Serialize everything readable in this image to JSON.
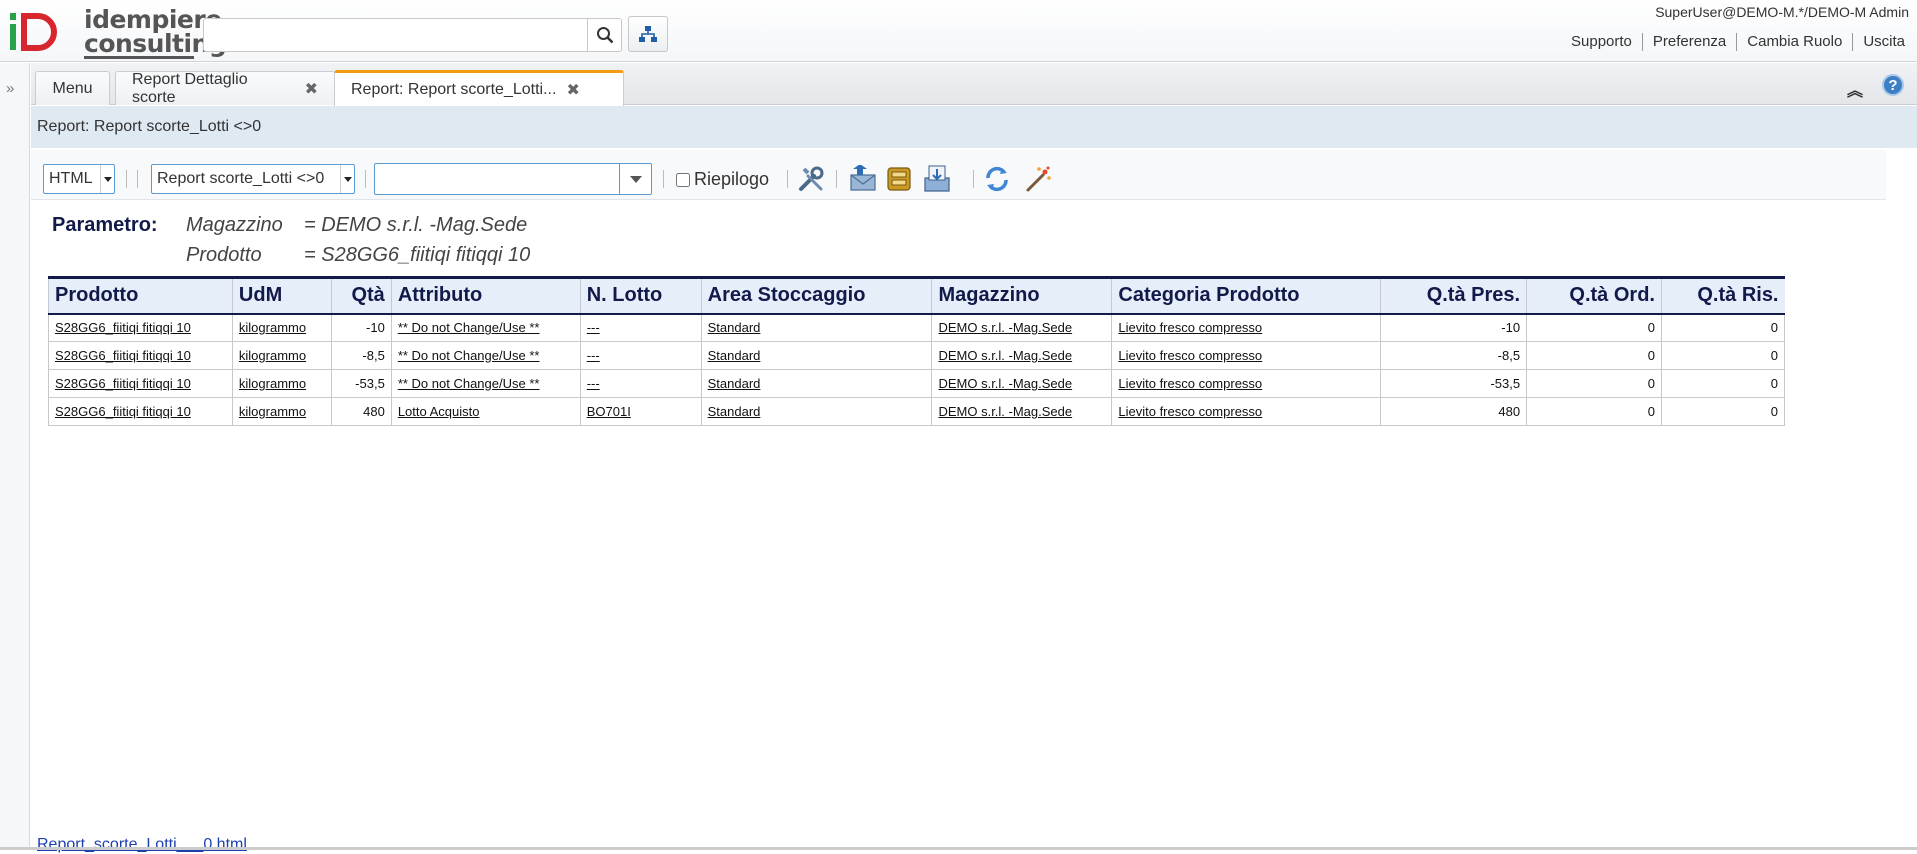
{
  "header": {
    "logo_text_line1": "idempiere",
    "logo_text_line2": "consulting",
    "search_placeholder": "",
    "user": "SuperUser@DEMO-M.*/DEMO-M Admin",
    "links": [
      "Supporto",
      "Preferenza",
      "Cambia Ruolo",
      "Uscita"
    ]
  },
  "tabs": {
    "menu": "Menu",
    "detail": "Report Dettaglio scorte",
    "report": "Report: Report scorte_Lotti...",
    "close_glyph": "✖"
  },
  "title_strip": "Report: Report scorte_Lotti <>0",
  "toolbar": {
    "format": "HTML",
    "report": "Report scorte_Lotti <>0",
    "combo_value": "",
    "summary_label": "Riepilogo"
  },
  "parameters": {
    "label": "Parametro:",
    "rows": [
      {
        "key": "Magazzino",
        "value": "= DEMO s.r.l. -Mag.Sede"
      },
      {
        "key": "Prodotto",
        "value": "= S28GG6_fiitiqi fitiqqi 10"
      }
    ]
  },
  "table": {
    "columns": [
      "Prodotto",
      "UdM",
      "Qtà",
      "Attributo",
      "N. Lotto",
      "Area Stoccaggio",
      "Magazzino",
      "Categoria Prodotto",
      "Q.tà Pres.",
      "Q.tà Ord.",
      "Q.tà Ris."
    ],
    "rows": [
      [
        "S28GG6_fiitiqi fitiqqi 10",
        "kilogrammo",
        "-10",
        "** Do not Change/Use **",
        "---",
        "Standard",
        "DEMO s.r.l. -Mag.Sede",
        "Lievito fresco compresso",
        "-10",
        "0",
        "0"
      ],
      [
        "S28GG6_fiitiqi fitiqqi 10",
        "kilogrammo",
        "-8,5",
        "** Do not Change/Use **",
        "---",
        "Standard",
        "DEMO s.r.l. -Mag.Sede",
        "Lievito fresco compresso",
        "-8,5",
        "0",
        "0"
      ],
      [
        "S28GG6_fiitiqi fitiqqi 10",
        "kilogrammo",
        "-53,5",
        "** Do not Change/Use **",
        "---",
        "Standard",
        "DEMO s.r.l. -Mag.Sede",
        "Lievito fresco compresso",
        "-53,5",
        "0",
        "0"
      ],
      [
        "S28GG6_fiitiqi fitiqqi 10",
        "kilogrammo",
        "480",
        "Lotto Acquisto",
        "BO701I",
        "Standard",
        "DEMO s.r.l. -Mag.Sede",
        "Lievito fresco compresso",
        "480",
        "0",
        "0"
      ]
    ]
  },
  "file_link": "Report_scorte_Lotti___0.html"
}
